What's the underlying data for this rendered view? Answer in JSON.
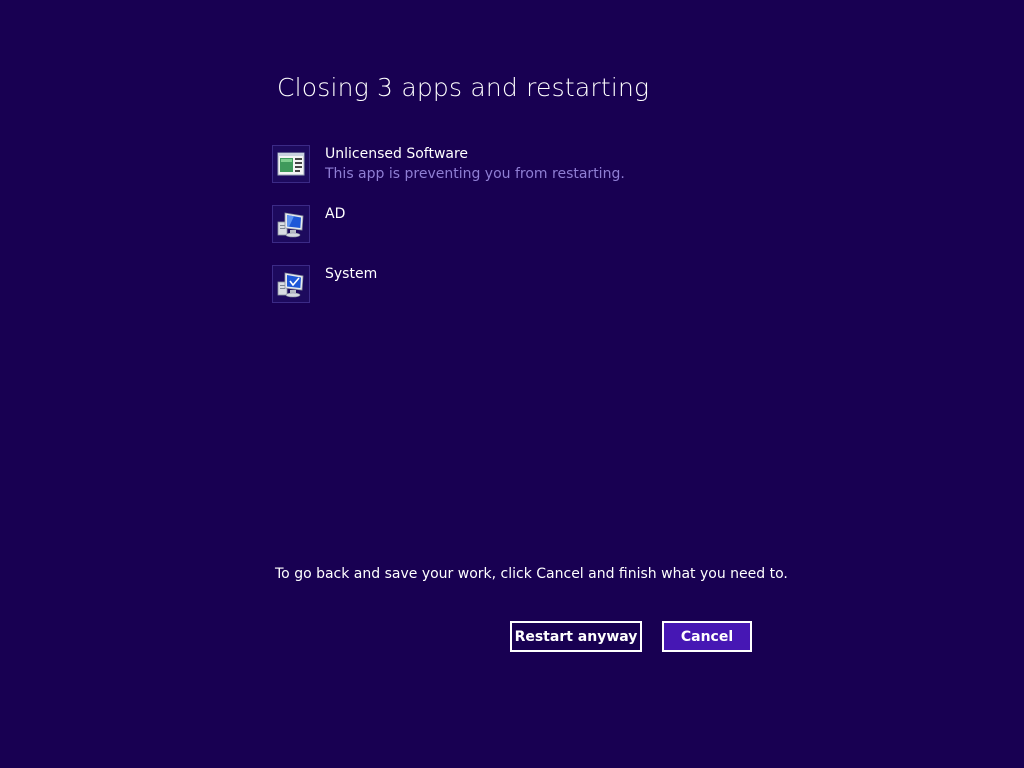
{
  "dialog": {
    "title": "Closing 3 apps and restarting",
    "note": "To go back and save your work, click Cancel and finish what you need to."
  },
  "apps": [
    {
      "name": "Unlicensed Software",
      "status": "This app is preventing you from restarting.",
      "icon": "application-window-icon"
    },
    {
      "name": "AD",
      "status": "",
      "icon": "computer-icon"
    },
    {
      "name": "System",
      "status": "",
      "icon": "computer-icon"
    }
  ],
  "buttons": {
    "restart_label": "Restart anyway",
    "cancel_label": "Cancel"
  },
  "colors": {
    "background": "#180052",
    "status_text": "#8f7ed4",
    "cancel_button": "#4617b4"
  }
}
